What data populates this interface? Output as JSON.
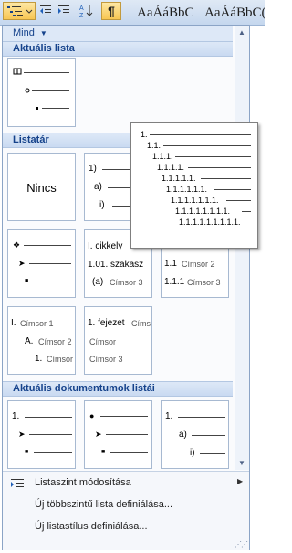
{
  "ribbon": {
    "bullets_icon": "bullets-icon",
    "decrease_indent_icon": "decrease-indent-icon",
    "increase_indent_icon": "increase-indent-icon",
    "sort_icon": "sort-icon",
    "pilcrow_label": "¶",
    "style_preview_1": "AaÁáBbC(",
    "style_preview_2": "AaÁáBbC("
  },
  "gallery": {
    "filter_label": "Mind",
    "sections": {
      "current": "Aktuális lista",
      "library": "Listatár",
      "document": "Aktuális dokumentumok listái"
    },
    "tiles": {
      "none_label": "Nincs",
      "t2": [
        "1)",
        "a)",
        "i)"
      ],
      "t4": [
        "I. cikkely",
        "1.01. szakasz",
        "(a)",
        "Címsor 3"
      ],
      "t5": [
        "1.1",
        "Címsor 2",
        "1.1.1",
        "Címsor 3"
      ],
      "t6": [
        "I.",
        "Címsor 1",
        "A.",
        "Címsor 2",
        "1.",
        "Címsor"
      ],
      "t7": [
        "1. fejezet",
        "Címsor",
        "Címsor",
        "Címsor 3"
      ],
      "d1": [
        "1."
      ],
      "d2": [
        "1."
      ],
      "d3": [
        "1.",
        "a)",
        "i)"
      ]
    }
  },
  "tooltip": {
    "levels": [
      "1.",
      "1.1.",
      "1.1.1.",
      "1.1.1.1.",
      "1.1.1.1.1.",
      "1.1.1.1.1.1.",
      "1.1.1.1.1.1.1.",
      "1.1.1.1.1.1.1.1.",
      "1.1.1.1.1.1.1.1.1."
    ]
  },
  "menu": {
    "change_level": "Listaszint módosítása",
    "new_multilevel": "Új többszintű lista definiálása...",
    "new_style": "Új listastílus definiálása..."
  },
  "colors": {
    "header_text": "#15428b",
    "active_button": "#f8c653"
  }
}
